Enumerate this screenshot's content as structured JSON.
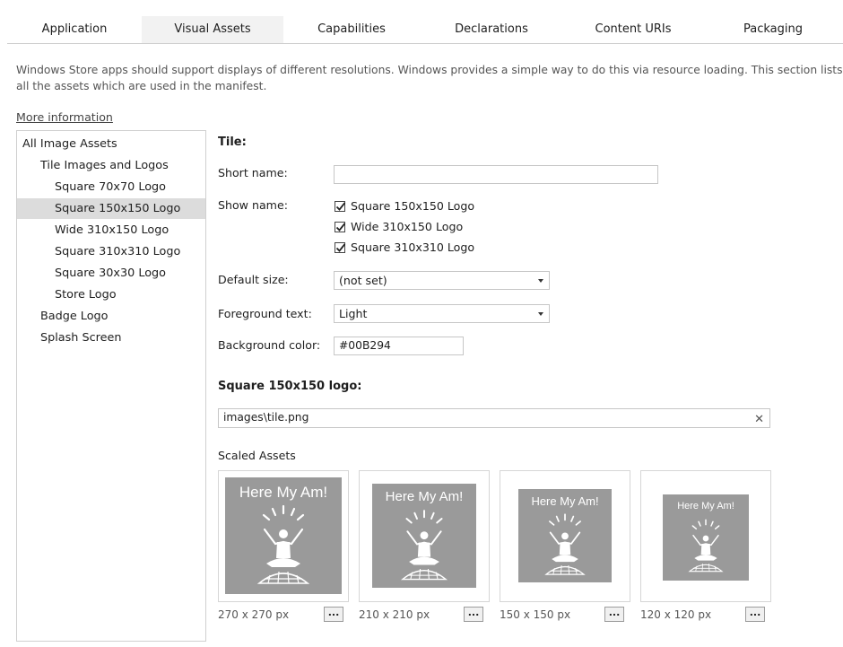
{
  "tabs": [
    {
      "label": "Application",
      "active": false
    },
    {
      "label": "Visual Assets",
      "active": true
    },
    {
      "label": "Capabilities",
      "active": false
    },
    {
      "label": "Declarations",
      "active": false
    },
    {
      "label": "Content URIs",
      "active": false
    },
    {
      "label": "Packaging",
      "active": false
    }
  ],
  "description": "Windows Store apps should support displays of different resolutions. Windows provides a simple way to do this via resource loading. This section lists all the assets which are used in the manifest.",
  "more_info_link": "More information",
  "tree": {
    "items": [
      {
        "label": "All Image Assets",
        "level": 0
      },
      {
        "label": "Tile Images and Logos",
        "level": 1
      },
      {
        "label": "Square 70x70 Logo",
        "level": 2
      },
      {
        "label": "Square 150x150 Logo",
        "level": 2,
        "selected": true
      },
      {
        "label": "Wide 310x150 Logo",
        "level": 2
      },
      {
        "label": "Square 310x310 Logo",
        "level": 2
      },
      {
        "label": "Square 30x30 Logo",
        "level": 2
      },
      {
        "label": "Store Logo",
        "level": 2
      },
      {
        "label": "Badge Logo",
        "level": 1
      },
      {
        "label": "Splash Screen",
        "level": 1
      }
    ]
  },
  "form": {
    "tile_heading": "Tile:",
    "short_name_label": "Short name:",
    "short_name_value": "",
    "show_name_label": "Show name:",
    "show_name_options": [
      {
        "label": "Square 150x150 Logo",
        "checked": true
      },
      {
        "label": "Wide 310x150 Logo",
        "checked": true
      },
      {
        "label": "Square 310x310 Logo",
        "checked": true
      }
    ],
    "default_size_label": "Default size:",
    "default_size_value": "(not set)",
    "foreground_text_label": "Foreground text:",
    "foreground_text_value": "Light",
    "background_color_label": "Background color:",
    "background_color_value": "#00B294",
    "logo_heading": "Square 150x150 logo:",
    "logo_path": "images\\tile.png",
    "clear_glyph": "✕",
    "scaled_assets_label": "Scaled Assets",
    "browse_label": "..."
  },
  "assets": [
    {
      "tile_text": "Here My Am!",
      "size": "270 x 270 px"
    },
    {
      "tile_text": "Here My Am!",
      "size": "210 x 210 px"
    },
    {
      "tile_text": "Here My Am!",
      "size": "150 x 150 px"
    },
    {
      "tile_text": "Here My Am!",
      "size": "120 x 120 px"
    }
  ],
  "colors": {
    "tile_gray": "#9a9a9a",
    "selected_tab_bg": "#f2f2f2",
    "selected_tree_bg": "#dcdcdc"
  }
}
